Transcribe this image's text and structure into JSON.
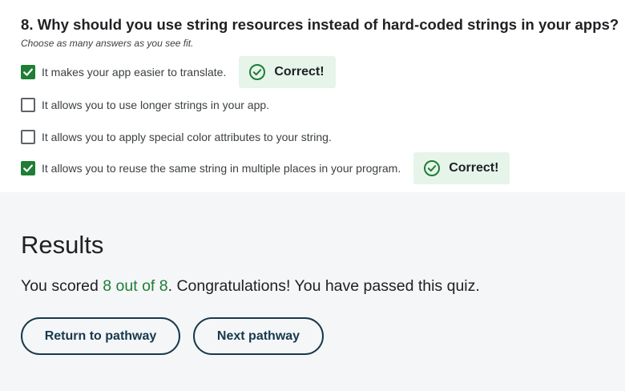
{
  "question": {
    "title": "8. Why should you use string resources instead of hard-coded strings in your apps?",
    "hint": "Choose as many answers as you see fit.",
    "options": [
      {
        "label": "It makes your app easier to translate.",
        "checked": true,
        "feedback": "Correct!"
      },
      {
        "label": "It allows you to use longer strings in your app.",
        "checked": false
      },
      {
        "label": "It allows you to apply special color attributes to your string.",
        "checked": false
      },
      {
        "label": "It allows you to reuse the same string in multiple places in your program.",
        "checked": true,
        "feedback": "Correct!"
      }
    ]
  },
  "results": {
    "heading": "Results",
    "score_prefix": "You scored ",
    "score_value": "8 out of 8",
    "score_suffix": ". Congratulations! You have passed this quiz.",
    "return_button": "Return to pathway",
    "next_button": "Next pathway"
  },
  "colors": {
    "correct_green": "#1e7e34",
    "correct_badge_bg": "#e6f4ea",
    "results_bg": "#f5f6f8",
    "button_border": "#17394d"
  },
  "icons": {
    "checkbox_checked": "check-icon",
    "feedback": "check-circle-icon"
  }
}
